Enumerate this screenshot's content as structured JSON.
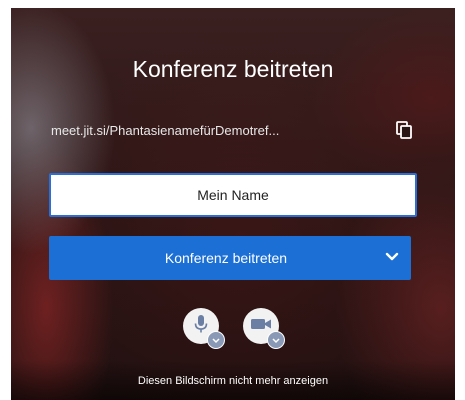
{
  "dialog": {
    "title": "Konferenz beitreten",
    "meeting_url": "meet.jit.si/PhantasienamefürDemotref...",
    "name_input": {
      "value": "Mein Name",
      "placeholder": ""
    },
    "join_button_label": "Konferenz beitreten",
    "footer_link": "Diesen Bildschirm nicht mehr anzeigen"
  },
  "icons": {
    "copy": "copy-icon",
    "dropdown": "chevron-down-icon",
    "mic": "microphone-icon",
    "camera": "camera-icon",
    "mic_badge": "chevron-down-icon",
    "camera_badge": "chevron-down-icon"
  },
  "colors": {
    "accent": "#1b6fd5",
    "input_border": "#2b6fd6",
    "media_button": "#f2f2f2",
    "badge": "#8a9ab6"
  }
}
